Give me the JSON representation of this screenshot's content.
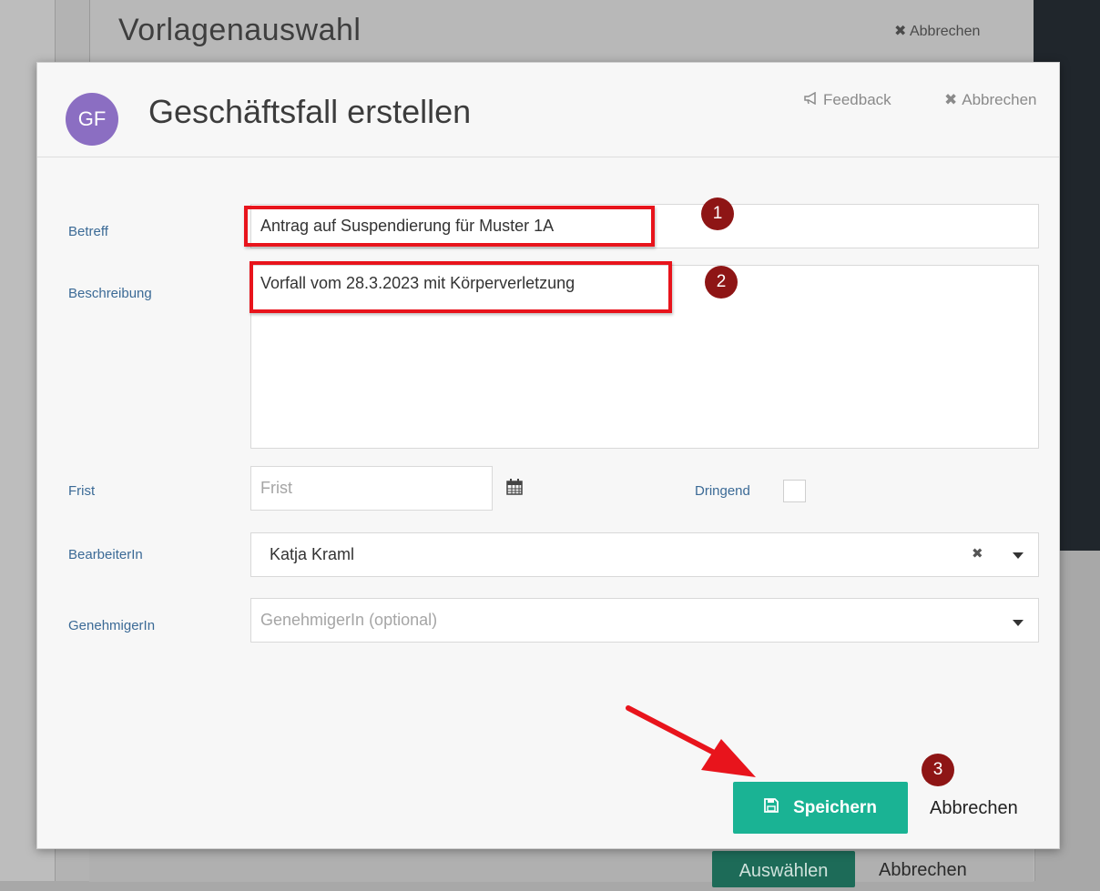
{
  "background": {
    "title": "Vorlagenauswahl",
    "cancel_label": "Abbrechen",
    "select_label": "Auswählen",
    "cancel2_label": "Abbrechen"
  },
  "modal": {
    "avatar_initials": "GF",
    "title": "Geschäftsfall erstellen",
    "feedback_label": "Feedback",
    "cancel_label": "Abbrechen"
  },
  "form": {
    "betreff_label": "Betreff",
    "betreff_value": "Antrag auf Suspendierung für Muster 1A",
    "beschreibung_label": "Beschreibung",
    "beschreibung_value": "Vorfall vom 28.3.2023 mit Körperverletzung",
    "frist_label": "Frist",
    "frist_placeholder": "Frist",
    "dringend_label": "Dringend",
    "bearbeiter_label": "BearbeiterIn",
    "bearbeiter_value": "Katja Kraml",
    "genehmiger_label": "GenehmigerIn",
    "genehmiger_placeholder": "GenehmigerIn (optional)"
  },
  "footer": {
    "save_label": "Speichern",
    "cancel_label": "Abbrechen"
  },
  "annotations": {
    "marker1": "1",
    "marker2": "2",
    "marker3": "3"
  },
  "colors": {
    "accent": "#1ab394",
    "avatar": "#8b6ec2",
    "annotation_red": "#e8141c",
    "marker": "#8e1515"
  }
}
